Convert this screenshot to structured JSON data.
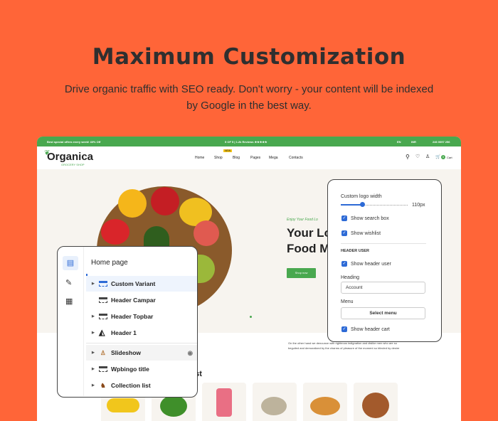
{
  "hero_title": "Maximum Customization",
  "hero_subtitle_line1": "Drive organic traffic with SEO ready.  Don't worry - your content will be indexed",
  "hero_subtitle_line2": "by Google in the best way.",
  "site": {
    "topbar": {
      "promo": "Best special offers every week! 40% Off",
      "reviews": "5 OF 5 | 1.2k Reviews ★★★★★",
      "language": "EN",
      "currency": "INR",
      "phone": "246 0097 256"
    },
    "logo": "Organica",
    "logo_tagline": "GROCERY SHOP",
    "nav": [
      "Home",
      "Shop",
      "Blog",
      "Pages",
      "Mega",
      "Contacts"
    ],
    "nav_badge": "NEW",
    "cart_label": "Cart",
    "cart_count": "0",
    "slide": {
      "kicker": "Enjoy Your Food Lo",
      "heading_line1": "Your Lo",
      "heading_line2": "Food M",
      "button": "Shop now"
    },
    "section_heading": "est",
    "section_text": "On the other hand we denounce with righteous indignation and dislike men who are so beguiled and demoralized by the charms of pleasure of the moment so blinded by desire"
  },
  "settings_panel": {
    "logo_width_label": "Custom logo width",
    "logo_width_value": "110px",
    "logo_width_fraction": 0.3,
    "show_search_box": "Show search box",
    "show_wishlist": "Show wishlist",
    "section_header_user": "HEADER USER",
    "show_header_user": "Show header user",
    "heading_label": "Heading",
    "heading_value": "Account",
    "menu_label": "Menu",
    "menu_button": "Select menu",
    "show_header_cart": "Show header cart",
    "accent": "#2d6ad6"
  },
  "sections_panel": {
    "title": "Home page",
    "items": [
      {
        "label": "Custom Variant"
      },
      {
        "label": "Header Campar"
      },
      {
        "label": "Header Topbar"
      },
      {
        "label": "Header 1"
      },
      {
        "label": "Slideshow"
      },
      {
        "label": "Wpbingo title"
      },
      {
        "label": "Collection list"
      }
    ]
  },
  "colors": {
    "background": "#ff6538",
    "brand_green": "#49a84f"
  }
}
